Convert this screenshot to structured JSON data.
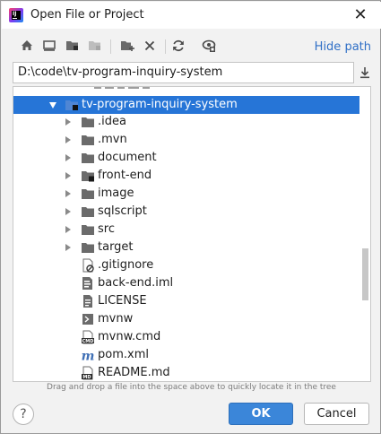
{
  "dialog": {
    "title": "Open File or Project",
    "close_icon": "close-icon",
    "app_icon": "intellij-idea-icon"
  },
  "toolbar": {
    "buttons": [
      {
        "name": "home-directory-button",
        "icon": "home-icon"
      },
      {
        "name": "desktop-directory-button",
        "icon": "desktop-icon"
      },
      {
        "name": "project-directory-button",
        "icon": "project-folder-icon"
      },
      {
        "name": "module-directory-button",
        "icon": "module-folder-icon",
        "disabled": true
      },
      {
        "name": "new-folder-button",
        "icon": "new-folder-icon"
      },
      {
        "name": "delete-button",
        "icon": "delete-x-icon"
      },
      {
        "name": "refresh-button",
        "icon": "refresh-icon"
      },
      {
        "name": "show-hidden-button",
        "icon": "show-hidden-icon"
      }
    ],
    "hide_path_label": "Hide path"
  },
  "path": {
    "value": "D:\\code\\tv-program-inquiry-system"
  },
  "tree": {
    "partial_top_label": "",
    "root": {
      "label": "tv-program-inquiry-system",
      "expanded": true,
      "selected": true
    },
    "children": [
      {
        "label": ".idea",
        "type": "folder",
        "expandable": true
      },
      {
        "label": ".mvn",
        "type": "folder",
        "expandable": true
      },
      {
        "label": "document",
        "type": "folder",
        "expandable": true
      },
      {
        "label": "front-end",
        "type": "module-folder",
        "expandable": true
      },
      {
        "label": "image",
        "type": "folder",
        "expandable": true
      },
      {
        "label": "sqlscript",
        "type": "folder",
        "expandable": true
      },
      {
        "label": "src",
        "type": "folder",
        "expandable": true
      },
      {
        "label": "target",
        "type": "folder",
        "expandable": true
      },
      {
        "label": ".gitignore",
        "type": "gitignore-file",
        "expandable": false
      },
      {
        "label": "back-end.iml",
        "type": "iml-file",
        "expandable": false
      },
      {
        "label": "LICENSE",
        "type": "text-file",
        "expandable": false
      },
      {
        "label": "mvnw",
        "type": "shell-file",
        "expandable": false
      },
      {
        "label": "mvnw.cmd",
        "type": "cmd-file",
        "expandable": false
      },
      {
        "label": "pom.xml",
        "type": "maven-file",
        "expandable": false
      },
      {
        "label": "README.md",
        "type": "markdown-file",
        "expandable": false
      }
    ]
  },
  "hint": "Drag and drop a file into the space above to quickly locate it in the tree",
  "footer": {
    "help_label": "?",
    "ok_label": "OK",
    "cancel_label": "Cancel"
  },
  "colors": {
    "selection": "#2675d7",
    "link": "#2f6fc6",
    "primary_button": "#3b86d9"
  }
}
